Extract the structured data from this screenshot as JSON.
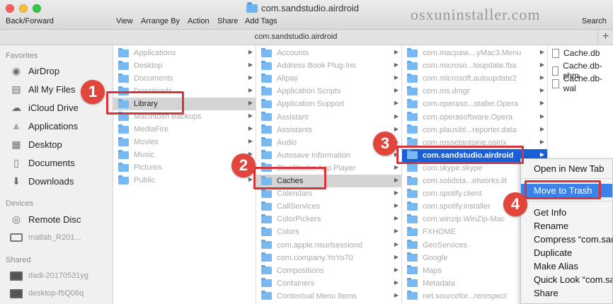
{
  "window": {
    "title": "com.sandstudio.airdroid",
    "path_title": "com.sandstudio.airdroid",
    "add_button": "+"
  },
  "toolbar": {
    "back_forward": "Back/Forward",
    "view": "View",
    "arrange_by": "Arrange By",
    "action": "Action",
    "share": "Share",
    "add_tags": "Add Tags",
    "search": "Search"
  },
  "watermark": "osxuninstaller.com",
  "sidebar": {
    "favorites_header": "Favorites",
    "favorites": [
      {
        "label": "AirDrop",
        "icon": "airdrop-icon"
      },
      {
        "label": "All My Files",
        "icon": "all-files-icon"
      },
      {
        "label": "iCloud Drive",
        "icon": "cloud-icon"
      },
      {
        "label": "Applications",
        "icon": "applications-icon"
      },
      {
        "label": "Desktop",
        "icon": "desktop-icon"
      },
      {
        "label": "Documents",
        "icon": "documents-icon"
      },
      {
        "label": "Downloads",
        "icon": "downloads-icon"
      }
    ],
    "devices_header": "Devices",
    "devices": [
      {
        "label": "Remote Disc"
      },
      {
        "label": "matlab_R201..."
      }
    ],
    "shared_header": "Shared",
    "shared": [
      {
        "label": "dadi-20170531yg"
      },
      {
        "label": "desktop-f5Q06q"
      }
    ]
  },
  "columns": {
    "col1": [
      "Applications",
      "Desktop",
      "Documents",
      "Downloads",
      "Library",
      "Macintosh Backups",
      "MediaFire",
      "Movies",
      "Music",
      "Pictures",
      "Public"
    ],
    "col2": [
      "Accounts",
      "Address Book Plug-Ins",
      "Alipay",
      "Application Scripts",
      "Application Support",
      "Assistant",
      "Assistants",
      "Audio",
      "Autosave Information",
      "BlueStacks App Player",
      "Caches",
      "Calendars",
      "CallServices",
      "ColorPickers",
      "Colors",
      "com.apple.nsurlsessiond",
      "com.company.YoYo70",
      "Compositions",
      "Containers",
      "Contextual Menu Items"
    ],
    "col3": [
      "com.macpaw....yMac3.Menu",
      "com.microso...toupdate.fba",
      "com.microsoft.autoupdate2",
      "com.ms.dmgr",
      "com.operaso...staller.Opera",
      "com.operasoftware.Opera",
      "com.plausibl...reporter.data",
      "com.rossetantoine.osirix",
      "com.sandstudio.airdroid",
      "com.skype.skype",
      "com.solidsta...etworks.lit",
      "com.spotify.client",
      "com.spotify.installer",
      "com.winzip.WinZip-Mac",
      "FXHOME",
      "GeoServices",
      "Google",
      "Maps",
      "Metadata",
      "net.sourcefor...rerespect"
    ],
    "col4": [
      "Cache.db",
      "Cache.db-shm",
      "Cache.db-wal"
    ]
  },
  "context_menu": {
    "items": [
      "Open in New Tab",
      "Move to Trash",
      "Get Info",
      "Rename",
      "Compress “com.sandstudio.airdroid”",
      "Duplicate",
      "Make Alias",
      "Quick Look “com.sandstudio.airdroid”",
      "Share"
    ]
  },
  "steps": [
    "1",
    "2",
    "3",
    "4"
  ],
  "colors": {
    "highlight": "#d9343a",
    "selection": "#1b5fd6",
    "menu_active": "#3d82e8",
    "folder": "#79b9f1"
  }
}
